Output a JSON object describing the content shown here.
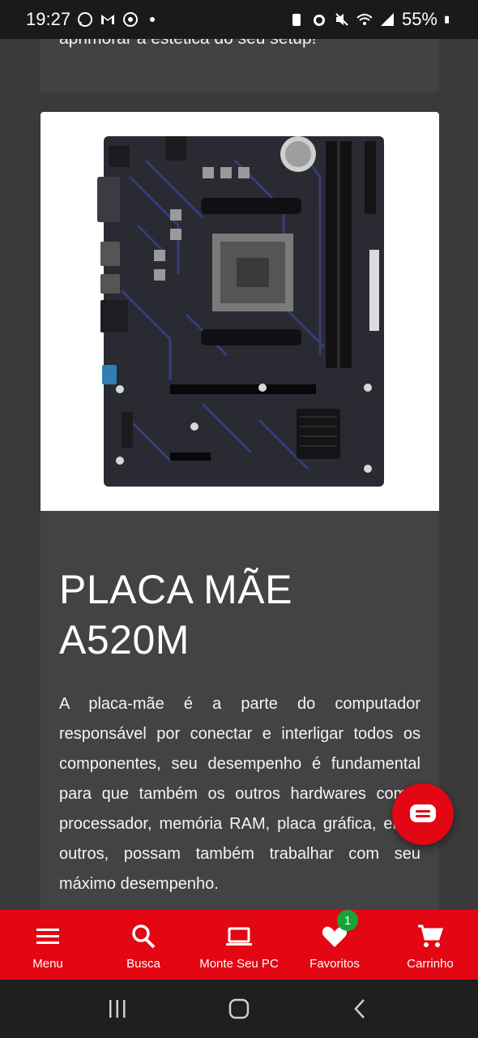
{
  "status_bar": {
    "time": "19:27",
    "battery": "55%",
    "left_icons": [
      "whatsapp-icon",
      "gmail-icon",
      "chrome-icon"
    ],
    "right_icons": [
      "battery-saver-icon",
      "alarm-icon",
      "mute-icon",
      "wifi-icon",
      "signal-icon",
      "battery-icon"
    ]
  },
  "previous_card": {
    "text": "aprimorar a estética do seu setup!"
  },
  "product": {
    "image_alt": "motherboard",
    "title": "PLACA MÃE A520M",
    "description": "A placa-mãe é a parte do computador responsável por conectar e interligar todos os componentes, seu desempenho é fundamental para que também os outros hardwares como, processador, memória RAM, placa gráfica, entre outros, possam também trabalhar com seu máximo desempenho."
  },
  "chat": {
    "icon": "chat-icon"
  },
  "bottom_nav": {
    "items": [
      {
        "label": "Menu",
        "icon": "menu-icon"
      },
      {
        "label": "Busca",
        "icon": "search-icon"
      },
      {
        "label": "Monte Seu PC",
        "icon": "laptop-icon"
      },
      {
        "label": "Favoritos",
        "icon": "heart-icon",
        "badge": "1"
      },
      {
        "label": "Carrinho",
        "icon": "cart-icon"
      }
    ]
  },
  "system_nav": {
    "icons": [
      "recents-icon",
      "home-icon",
      "back-icon"
    ]
  },
  "colors": {
    "brand_red": "#e30613",
    "badge_green": "#18a33a",
    "background": "#3a3a3a"
  }
}
